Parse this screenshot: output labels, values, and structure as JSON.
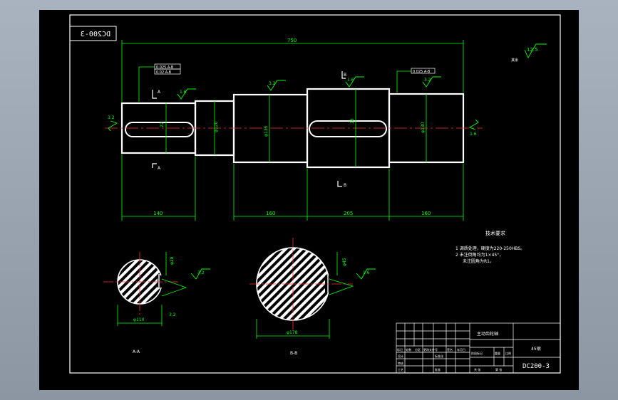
{
  "drawing": {
    "code_stamp": "DC200-3",
    "overall_length": "750",
    "dims": {
      "seg1": "140",
      "seg3": "160",
      "seg4": "205",
      "seg5": "160",
      "d2": "φ120",
      "d3": "φ135",
      "d5": "φ130",
      "keyway_depth": "22",
      "keyway_depth2": "28"
    },
    "tolerances": {
      "left_frame": [
        "0.025 A-B",
        "0.02 A-B"
      ],
      "right_frame": "0.025 A-B"
    },
    "roughness": {
      "corner": "12.5",
      "other_label": "其余",
      "marks": [
        "1.6",
        "3.2",
        "1.6",
        "3.2",
        "3.2",
        "1.6",
        "3.2",
        "1.6",
        "3.2"
      ]
    },
    "section_markers": [
      "A",
      "A",
      "B",
      "B"
    ],
    "sections": {
      "a_dia": "φ110",
      "b_dia": "φ178",
      "a_keyway": "φ28",
      "b_keyway": "φ45",
      "a_label": "A-A",
      "b_label": "B-B"
    },
    "tech_req": {
      "title": "技术要求",
      "lines": [
        "1 调质处理，硬度为220-250HBS。",
        "2 未注倒角均为1×45°，",
        "未注圆角为R1。"
      ]
    },
    "title_block": {
      "part_name": "主动齿轮轴",
      "material": "45钢",
      "drawing_no": "DC200-3",
      "header_cells": [
        "标记",
        "处数",
        "分区",
        "更改文件号",
        "签名",
        "年月日"
      ],
      "row_labels": [
        "设计",
        "审核",
        "工艺"
      ],
      "mid_labels": [
        "标准化",
        "批准"
      ],
      "stage_labels": [
        "阶段标记",
        "重量",
        "比例"
      ],
      "bottom_labels": [
        "共 张",
        "第 张"
      ]
    }
  }
}
